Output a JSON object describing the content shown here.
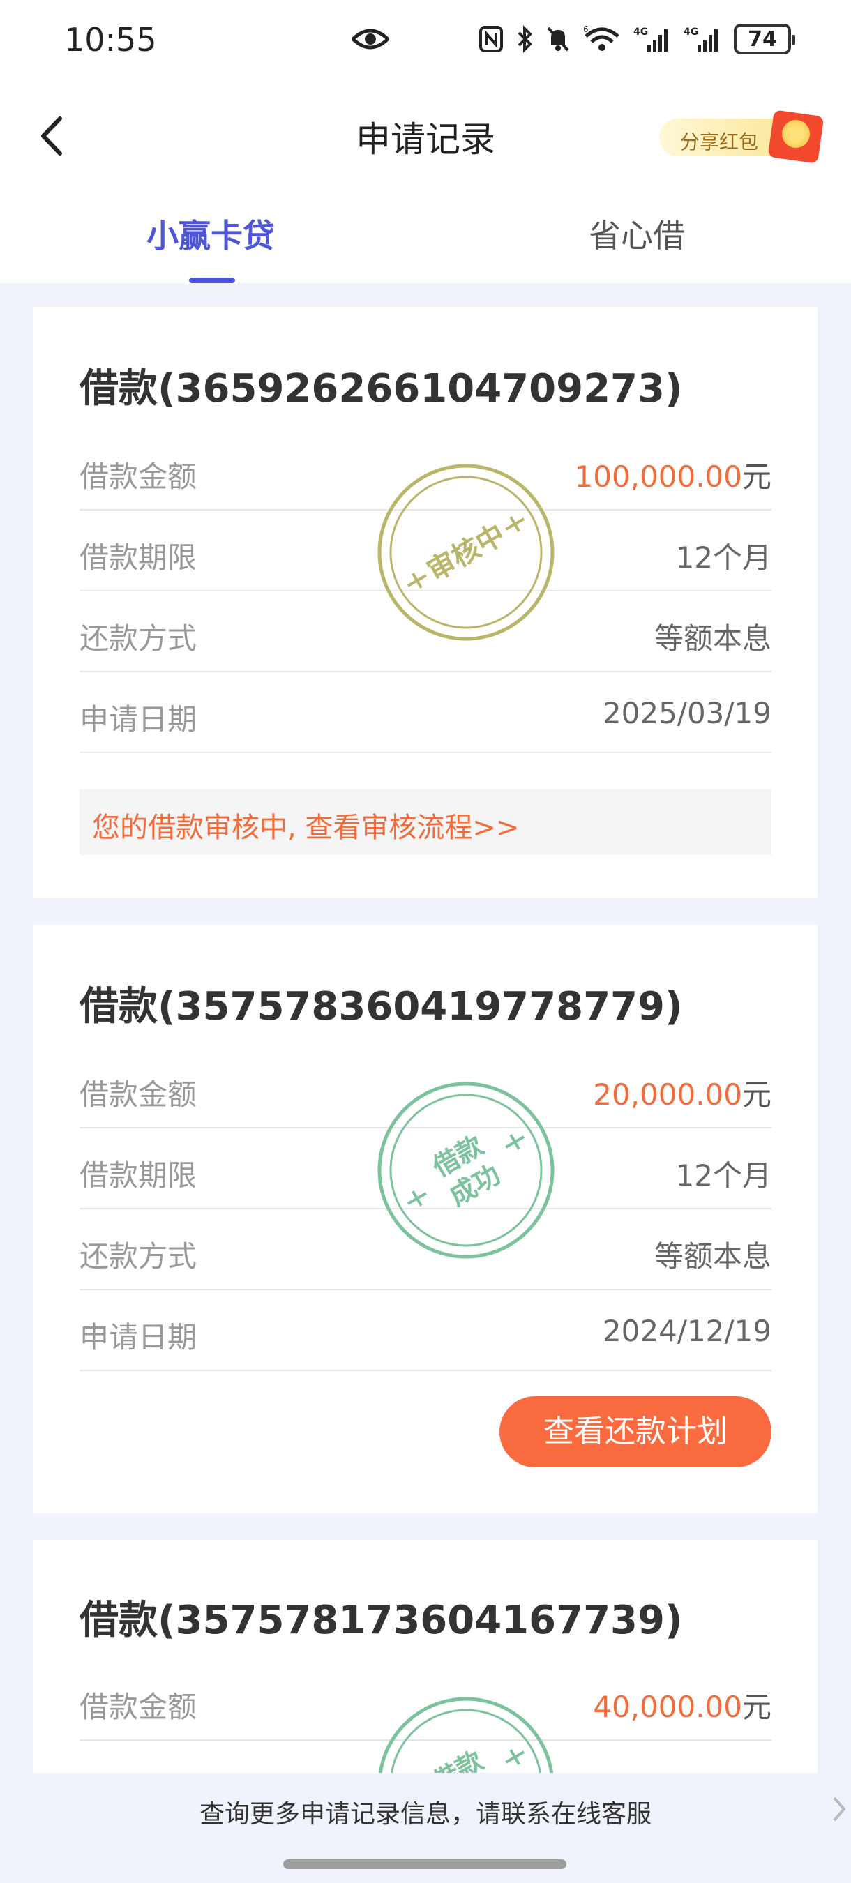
{
  "status_bar": {
    "time": "10:55",
    "battery": "74",
    "net_label_1": "4G",
    "net_label_2": "4G",
    "wifi_label": "6"
  },
  "header": {
    "title": "申请记录",
    "share_label": "分享红包"
  },
  "tabs": [
    {
      "label": "小赢卡贷",
      "active": true
    },
    {
      "label": "省心借",
      "active": false
    }
  ],
  "loans": [
    {
      "title": "借款(365926266104709273)",
      "rows": [
        {
          "label": "借款金额",
          "value": "100,000.00",
          "unit": "元"
        },
        {
          "label": "借款期限",
          "value": "12个月"
        },
        {
          "label": "还款方式",
          "value": "等额本息"
        },
        {
          "label": "申请日期",
          "value": "2025/03/19"
        }
      ],
      "stamp": {
        "text": "审核中",
        "color": "#b9b66a"
      },
      "notice": "您的借款审核中, 查看审核流程>>"
    },
    {
      "title": "借款(357578360419778779)",
      "rows": [
        {
          "label": "借款金额",
          "value": "20,000.00",
          "unit": "元"
        },
        {
          "label": "借款期限",
          "value": "12个月"
        },
        {
          "label": "还款方式",
          "value": "等额本息"
        },
        {
          "label": "申请日期",
          "value": "2024/12/19"
        }
      ],
      "stamp": {
        "line1": "借款",
        "line2": "成功",
        "color": "#7cc29c"
      },
      "button": "查看还款计划"
    },
    {
      "title": "借款(357578173604167739)",
      "rows": [
        {
          "label": "借款金额",
          "value": "40,000.00",
          "unit": "元"
        }
      ],
      "stamp": {
        "line1": "借款",
        "color": "#7cc29c"
      }
    }
  ],
  "footer": {
    "text": "查询更多申请记录信息，请联系在线客服"
  },
  "colors": {
    "accent": "#4f56d6",
    "amount": "#f26b3a",
    "button": "#fb6b40",
    "background": "#f0f3fb"
  }
}
